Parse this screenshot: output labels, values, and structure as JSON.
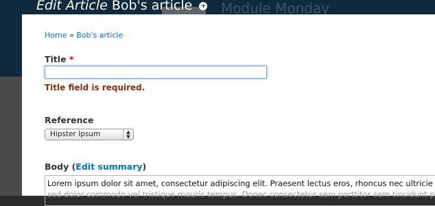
{
  "header": {
    "title_italic": "Edit Article",
    "title_rest": "Bob's article",
    "add_icon": "plus-circle-icon",
    "background_site_title": "Module Monday"
  },
  "breadcrumb": {
    "home": "Home",
    "separator": "»",
    "current": "Bob's article"
  },
  "form": {
    "title_label": "Title",
    "required_marker": "*",
    "title_value": "",
    "title_error": "Title field is required.",
    "reference_label": "Reference",
    "reference_selected": "Hipster Ipsum",
    "body_label": "Body",
    "body_paren_open": "(",
    "edit_summary_link": "Edit summary",
    "body_paren_close": ")",
    "body_line1": "Lorem ipsum dolor sit amet, consectetur adipiscing elit. Praesent lectus eros, rhoncus nec ultricie",
    "body_line2": "sed dolor commodo vel tristique mauris tempus. Donec consectetur sem porttitor sem tincidunt p"
  }
}
